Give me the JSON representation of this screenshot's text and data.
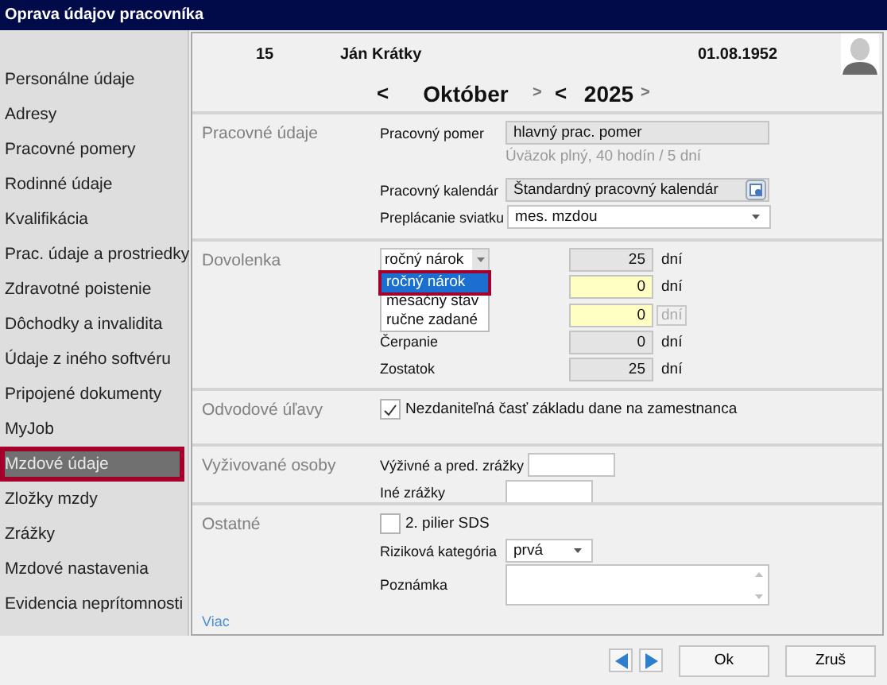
{
  "window": {
    "title": "Oprava údajov pracovníka"
  },
  "sidebar": {
    "items": [
      {
        "label": "Personálne údaje",
        "selected": false
      },
      {
        "label": "Adresy",
        "selected": false
      },
      {
        "label": "Pracovné pomery",
        "selected": false
      },
      {
        "label": "Rodinné údaje",
        "selected": false
      },
      {
        "label": "Kvalifikácia",
        "selected": false
      },
      {
        "label": "Prac. údaje a prostriedky",
        "selected": false
      },
      {
        "label": "Zdravotné poistenie",
        "selected": false
      },
      {
        "label": "Dôchodky a invalidita",
        "selected": false
      },
      {
        "label": "Údaje z iného softvéru",
        "selected": false
      },
      {
        "label": "Pripojené dokumenty",
        "selected": false
      },
      {
        "label": "MyJob",
        "selected": false
      },
      {
        "label": "Mzdové údaje",
        "selected": true
      },
      {
        "label": "Zložky mzdy",
        "selected": false
      },
      {
        "label": "Zrážky",
        "selected": false
      },
      {
        "label": "Mzdové nastavenia",
        "selected": false
      },
      {
        "label": "Evidencia neprítomnosti",
        "selected": false
      }
    ]
  },
  "header": {
    "number": "15",
    "name": "Ján Krátky",
    "birth_date": "01.08.1952"
  },
  "period": {
    "prev_month": "<",
    "month": "Október",
    "next_month": ">",
    "prev_year": "<",
    "year": "2025",
    "next_year": ">"
  },
  "sections": [
    {
      "title": "Pracovné údaje",
      "rows": [
        {
          "kind": "readonly",
          "label": "Pracovný pomer",
          "value": "hlavný prac. pomer"
        },
        {
          "kind": "hint",
          "value": "Úväzok plný, 40 hodín  / 5 dní"
        },
        {
          "kind": "lookup",
          "label": "Pracovný kalendár",
          "value": "Štandardný pracovný kalendár"
        },
        {
          "kind": "select",
          "label": "Preplácanie sviatku",
          "value": "mes. mzdou"
        }
      ]
    },
    {
      "title": "Dovolenka",
      "dropdown": {
        "options": [
          {
            "label": "ročný nárok",
            "selected": true
          },
          {
            "label": "mesačný stav",
            "selected": false
          },
          {
            "label": "ručne zadané",
            "selected": false
          }
        ]
      },
      "rows": [
        {
          "kind": "combo-number",
          "combo": "ročný nárok",
          "value": "25",
          "unit": "dní",
          "editable": false,
          "unit_disabled": false
        },
        {
          "kind": "number",
          "value": "0",
          "unit": "dní",
          "editable": true,
          "unit_disabled": false
        },
        {
          "kind": "number",
          "value": "0",
          "unit": "dní",
          "editable": true,
          "unit_disabled": true
        },
        {
          "kind": "number",
          "label": "Čerpanie",
          "value": "0",
          "unit": "dní",
          "editable": false,
          "unit_disabled": false
        },
        {
          "kind": "number",
          "label": "Zostatok",
          "value": "25",
          "unit": "dní",
          "editable": false,
          "unit_disabled": false
        }
      ]
    },
    {
      "title": "Odvodové úľavy",
      "rows": [
        {
          "kind": "checkbox",
          "label": "Nezdaniteľná časť základu dane na zamestnanca",
          "checked": true
        }
      ]
    },
    {
      "title": "Vyživované osoby",
      "rows": [
        {
          "kind": "text",
          "label": "Výživné a pred. zrážky"
        },
        {
          "kind": "text",
          "label": "Iné zrážky"
        }
      ]
    },
    {
      "title": "Ostatné",
      "rows": [
        {
          "kind": "checkbox",
          "label": "2. pilier SDS",
          "checked": false
        },
        {
          "kind": "short-select",
          "label": "Riziková kategória",
          "value": "prvá"
        },
        {
          "kind": "textarea",
          "label": "Poznámka"
        }
      ]
    }
  ],
  "more_link": "Viac",
  "buttons": {
    "ok": "Ok",
    "cancel": "Zruš"
  }
}
